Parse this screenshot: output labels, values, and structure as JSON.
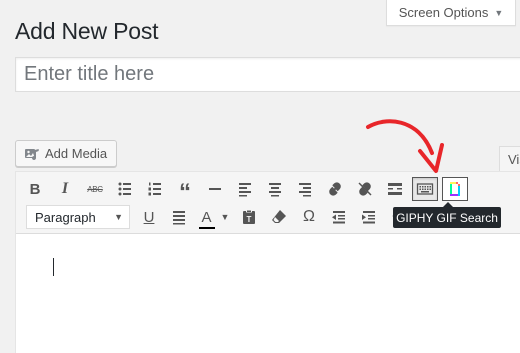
{
  "screen_options": {
    "label": "Screen Options",
    "icon": "caret-down-icon"
  },
  "page": {
    "title": "Add New Post"
  },
  "title_field": {
    "placeholder": "Enter title here"
  },
  "media": {
    "add_media_label": "Add Media",
    "icon": "add-media-icon"
  },
  "editor_tabs": {
    "visual_label": "Vis"
  },
  "toolbar": {
    "bold": "B",
    "italic": "I",
    "strikethrough": "ABC",
    "blockquote": "“",
    "format_select": "Paragraph",
    "text_color": "A",
    "special_chars": "Ω",
    "underline": "U"
  },
  "tooltip": {
    "text": "GIPHY GIF Search"
  },
  "colors": {
    "annotation_arrow": "#e8262a",
    "giphy_gradient": [
      "#00ff99",
      "#00ccff",
      "#9933ff",
      "#ff6666",
      "#fff35c"
    ],
    "text_color_bar": "#000000"
  }
}
